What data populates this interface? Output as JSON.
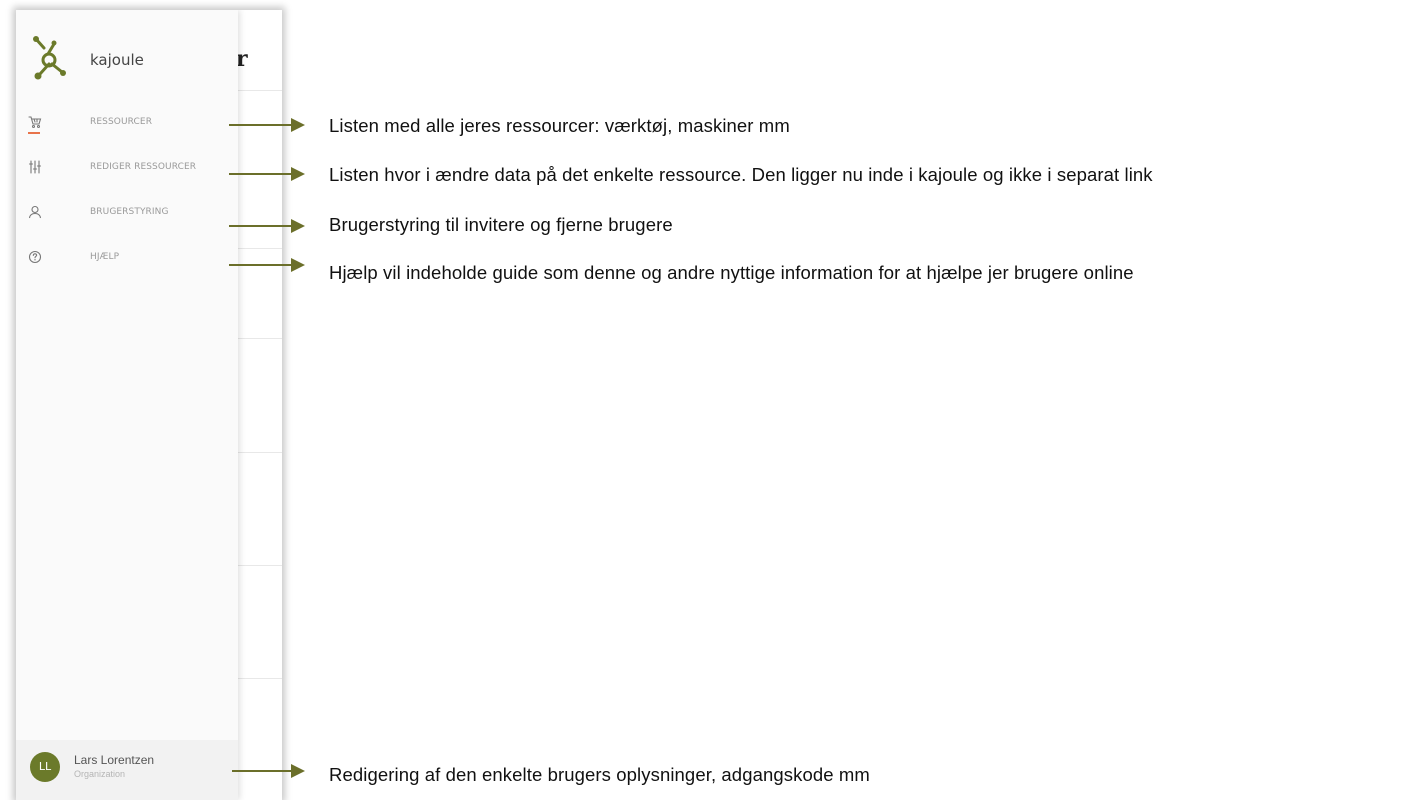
{
  "app": {
    "brand_name": "kajoule",
    "background_title": "r"
  },
  "nav": {
    "items": [
      {
        "label": "RESSOURCER",
        "icon": "cart-icon",
        "active": true
      },
      {
        "label": "REDIGER RESSOURCER",
        "icon": "sliders-icon",
        "active": false
      },
      {
        "label": "BRUGERSTYRING",
        "icon": "user-icon",
        "active": false
      },
      {
        "label": "HJÆLP",
        "icon": "help-icon",
        "active": false
      }
    ]
  },
  "user": {
    "initials": "LL",
    "name": "Lars Lorentzen",
    "organization": "Organization"
  },
  "annotations": [
    "Listen med alle jeres ressourcer: værktøj, maskiner mm",
    "Listen hvor i ændre data på det enkelte ressource. Den ligger nu inde i kajoule og ikke i separat link",
    "Brugerstyring til invitere og fjerne brugere",
    "Hjælp vil indeholde guide som denne og andre nyttige information for at hjælpe jer brugere online",
    "Redigering af den enkelte brugers oplysninger, adgangskode mm"
  ],
  "colors": {
    "accent": "#e8734a",
    "brand_green": "#6b7a2a",
    "arrow": "#6b6f2a"
  }
}
